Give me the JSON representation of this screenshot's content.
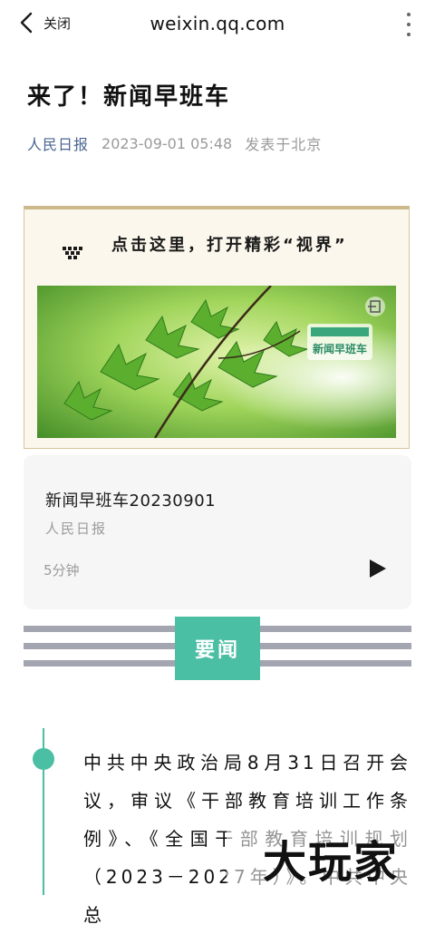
{
  "topbar": {
    "close_label": "关闭",
    "url": "weixin.qq.com"
  },
  "article": {
    "title": "来了！新闻早班车",
    "source": "人民日报",
    "datetime": "2023-09-01 05:48",
    "location": "发表于北京"
  },
  "promo": {
    "text": "点击这里，打开精彩“视界”",
    "image_badge": "新闻早班车"
  },
  "audio": {
    "title": "新闻早班车20230901",
    "source": "人民日报",
    "duration": "5分钟"
  },
  "section": {
    "label": "要闻"
  },
  "body": {
    "paragraph": "中共中央政治局8月31日召开会议，审议《干部教育培训工作条例》、《全国干部教育培训规划（2023－2027年）》。中共中央总"
  },
  "watermark": {
    "text": "大玩家"
  },
  "colors": {
    "accent": "#4bbfa3",
    "source_link": "#4a6590",
    "promo_border": "#cbb98a",
    "stripe": "#a3a5b0"
  }
}
